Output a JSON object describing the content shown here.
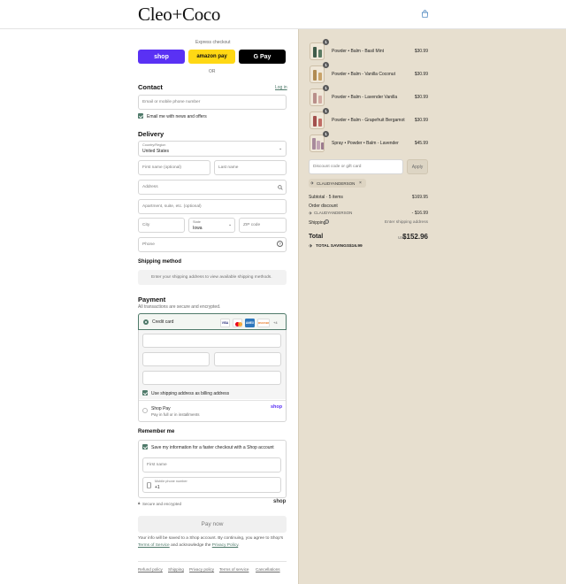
{
  "brand": {
    "name": "Cleo+Coco"
  },
  "express": {
    "label": "Express checkout",
    "shop": "shop",
    "amazon": "amazon pay",
    "gpay": "G Pay",
    "or": "OR"
  },
  "contact": {
    "title": "Contact",
    "login": "Log in",
    "placeholder": "Email or mobile phone number",
    "news": "Email me with news and offers"
  },
  "delivery": {
    "title": "Delivery",
    "country_label": "Country/Region",
    "country": "United States",
    "first": "First name (optional)",
    "last": "Last name",
    "address": "Address",
    "apt": "Apartment, suite, etc. (optional)",
    "city": "City",
    "state_label": "State",
    "state": "Iowa",
    "zip": "ZIP code",
    "phone": "Phone"
  },
  "shipping": {
    "title": "Shipping method",
    "note": "Enter your shipping address to view available shipping methods."
  },
  "payment": {
    "title": "Payment",
    "secure": "All transactions are secure and encrypted.",
    "credit": "Credit card",
    "cards": [
      "VISA",
      "MC",
      "AMEX",
      "DISCOVER"
    ],
    "more": "+4",
    "billing": "Use shipping address as billing address",
    "shoppay": "Shop Pay",
    "shoppay_sub": "Pay in full or in installments",
    "shoppay_logo": "shop"
  },
  "remember": {
    "title": "Remember me",
    "save": "Save my information for a faster checkout with a Shop account",
    "first": "First name",
    "mobile_label": "Mobile phone number",
    "mobile": "+1",
    "secure": "Secure and encrypted",
    "shop": "shop"
  },
  "pay_now": "Pay now",
  "disclaimer": {
    "line1": "Your info will be saved to a Shop account. By continuing, you agree to Shop's",
    "tos": "Terms of Service",
    "mid": "and acknowledge the",
    "privacy": "Privacy Policy",
    "end": "."
  },
  "footer": [
    "Refund policy",
    "Shipping",
    "Privacy policy",
    "Terms of service",
    "Cancellations"
  ],
  "items": [
    {
      "qty": "1",
      "name": "Powder • Balm - Basil Mint",
      "price": "$30.99"
    },
    {
      "qty": "1",
      "name": "Powder • Balm - Vanilla Coconut",
      "price": "$30.99"
    },
    {
      "qty": "1",
      "name": "Powder • Balm - Lavender Vanilla",
      "price": "$30.99"
    },
    {
      "qty": "1",
      "name": "Powder • Balm - Grapefruit Bergamot",
      "price": "$30.99"
    },
    {
      "qty": "1",
      "name": "Spray • Powder • Balm - Lavender",
      "price": "$45.99"
    }
  ],
  "discount": {
    "placeholder": "Discount code or gift card",
    "apply": "Apply",
    "code": "CLAUDYANDERSON"
  },
  "summary": {
    "subtotal_label": "Subtotal · 5 items",
    "subtotal": "$169.95",
    "order_discount": "Order discount",
    "code": "CLAUDYANDERSON",
    "discount": "- $16.99",
    "shipping_label": "Shipping",
    "shipping": "Enter shipping address",
    "total_label": "Total",
    "currency": "USD",
    "total": "$152.96",
    "savings_label": "TOTAL SAVINGS",
    "savings": "$16.99"
  },
  "colors": {
    "shop": "#5a31f4",
    "amazon": "#ffd814",
    "gpay": "#000000",
    "accent": "#4f7a6a",
    "sidebar": "#e7dfcf"
  }
}
